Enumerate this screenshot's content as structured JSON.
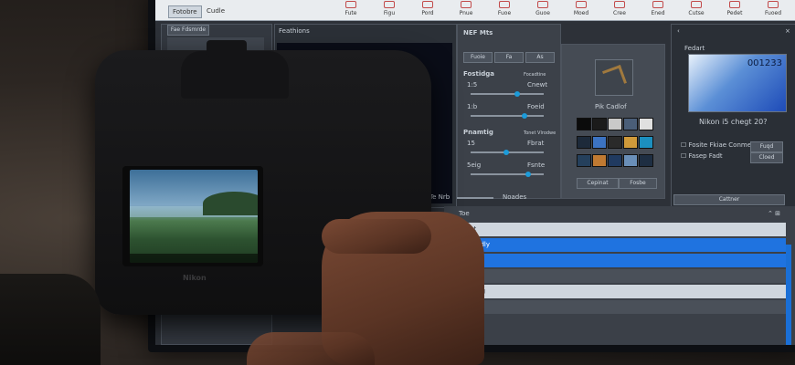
{
  "app": {
    "tabs": [
      "Fotobre",
      "Cudle"
    ],
    "toolbar": [
      "Fute",
      "Figu",
      "Pord",
      "Pnue",
      "Fuoe",
      "Guoe",
      "Moed",
      "Cree",
      "Ened",
      "Cutse",
      "Pedet",
      "Fuoed"
    ]
  },
  "left_panel": {
    "button": "Fae Fdsmrde"
  },
  "preview": {
    "title": "Feathions"
  },
  "adjust": {
    "title": "NEF Mts",
    "row_labels": [
      "Fuoie",
      "Fa",
      "As"
    ],
    "section1": {
      "title": "Fostidga",
      "right": "Focadtine",
      "sliders": [
        {
          "label": "1:5",
          "value": "Cnewt"
        },
        {
          "label": "1:b",
          "value": "Foeid"
        }
      ]
    },
    "section2": {
      "title": "Pnamtig",
      "right": "Tonet Vlrodwe",
      "sliders": [
        {
          "label": "15",
          "value": "Fbrat"
        },
        {
          "label": "5eig",
          "value": "Fsnte"
        }
      ]
    },
    "bottom_left": "Te Nrb",
    "bottom_right": "Noades"
  },
  "presets": {
    "label": "Pik Cadlof",
    "buttons": [
      "Cepinat",
      "Fosbe"
    ]
  },
  "info_panel": {
    "title": "Fedart",
    "counter": "001233",
    "caption": "Nikon i5 chegt 20?",
    "checks": [
      {
        "label": "Fosite Fkiae Conmeras",
        "button": "Fuqd"
      },
      {
        "label": "Fasep Fadt",
        "button": "Cloed"
      }
    ],
    "footer": "Cattner"
  },
  "list": {
    "header": "Toe",
    "rows": [
      "Fanet",
      "Pucmadly",
      "Sosfee",
      "Fadlo",
      "Ssecilng",
      "Salt"
    ],
    "selected": [
      1,
      2
    ]
  },
  "colors": {
    "accent": "#1f73e0",
    "accent_dark": "#1560c8"
  },
  "camera": {
    "brand": "Nikon"
  }
}
